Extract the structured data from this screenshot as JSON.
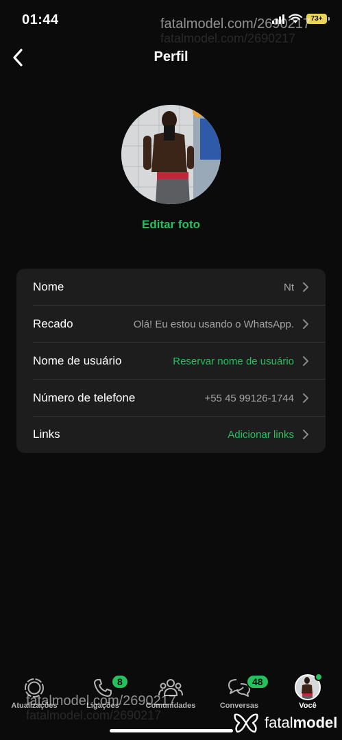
{
  "status_bar": {
    "time": "01:44",
    "battery": "73+"
  },
  "watermark": {
    "url": "fatalmodel.com/2690217",
    "logo_light": "fatal",
    "logo_bold": "model"
  },
  "header": {
    "title": "Perfil",
    "back_icon": "chevron-left-icon"
  },
  "profile": {
    "edit_photo_label": "Editar foto"
  },
  "fields": [
    {
      "label": "Nome",
      "value": "Nt",
      "value_color": "gray"
    },
    {
      "label": "Recado",
      "value": "Olá! Eu estou usando o WhatsApp.",
      "value_color": "gray"
    },
    {
      "label": "Nome de usuário",
      "value": "Reservar nome de usuário",
      "value_color": "green"
    },
    {
      "label": "Número de telefone",
      "value": "+55 45 99126-1744",
      "value_color": "gray"
    },
    {
      "label": "Links",
      "value": "Adicionar links",
      "value_color": "green"
    }
  ],
  "tabs": [
    {
      "label": "Atualizações",
      "icon": "status-icon"
    },
    {
      "label": "Ligações",
      "icon": "phone-icon",
      "badge": "8"
    },
    {
      "label": "Comunidades",
      "icon": "community-icon"
    },
    {
      "label": "Conversas",
      "icon": "chat-icon",
      "badge": "48"
    },
    {
      "label": "Você",
      "icon": "avatar",
      "active": true
    }
  ],
  "colors": {
    "background": "#0b0b0b",
    "card": "#1d1d1e",
    "accent_green": "#25c15f",
    "muted_text": "#a5a5a5"
  }
}
